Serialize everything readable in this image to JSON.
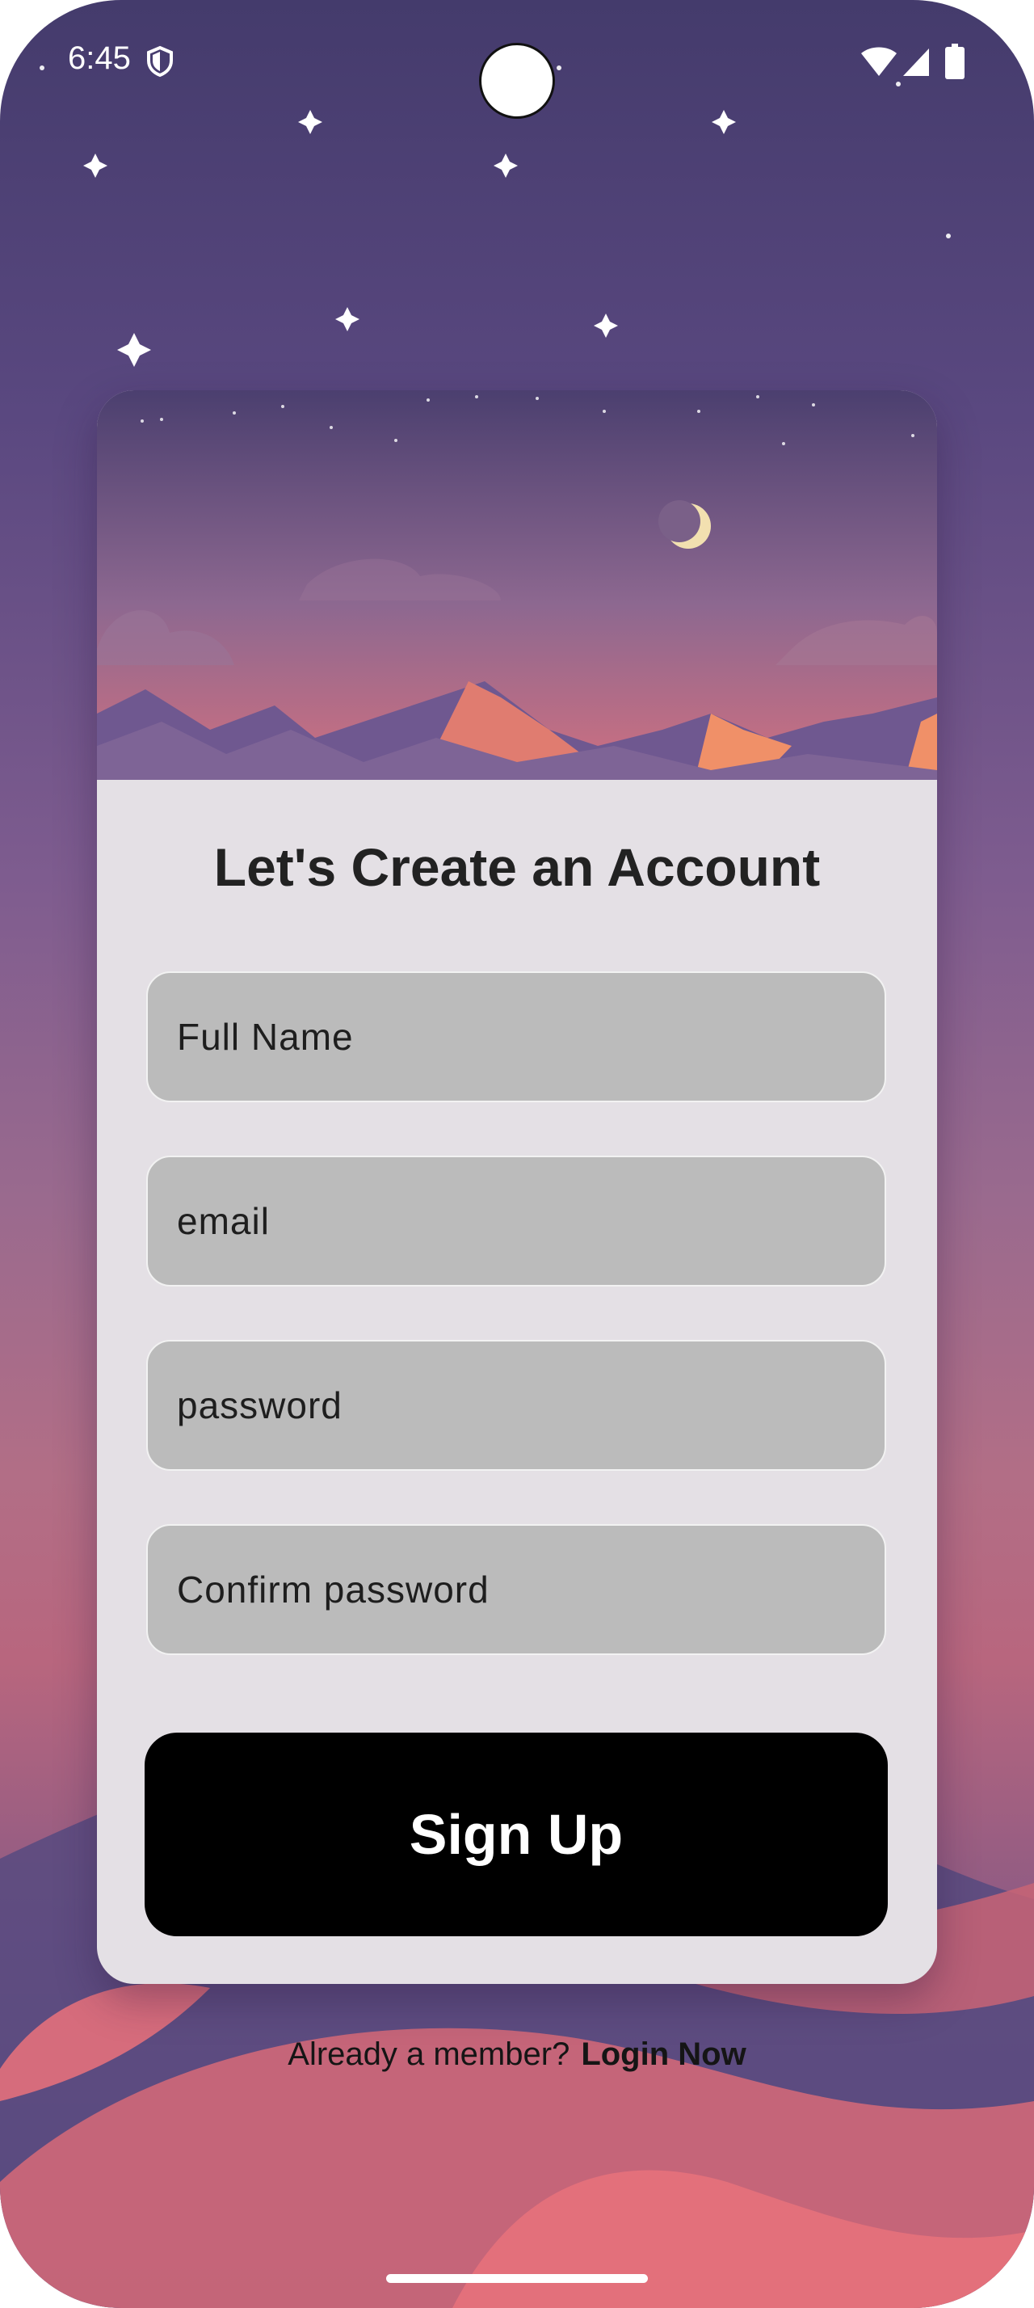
{
  "status_bar": {
    "time": "6:45",
    "icons": [
      "shield-icon",
      "wifi-icon",
      "signal-icon",
      "battery-icon"
    ]
  },
  "signup": {
    "title": "Let's Create an Account",
    "fields": {
      "full_name_placeholder": "Full Name",
      "email_placeholder": "email",
      "password_placeholder": "password",
      "confirm_password_placeholder": "Confirm password"
    },
    "submit_label": "Sign Up"
  },
  "footer": {
    "prompt": "Already a member?",
    "login_label": "Login Now"
  },
  "colors": {
    "background_top": "#443b6c",
    "background_bottom": "#b8667e",
    "card": "#e4e0e5",
    "input_fill": "#bbbbbb",
    "button": "#000000"
  }
}
